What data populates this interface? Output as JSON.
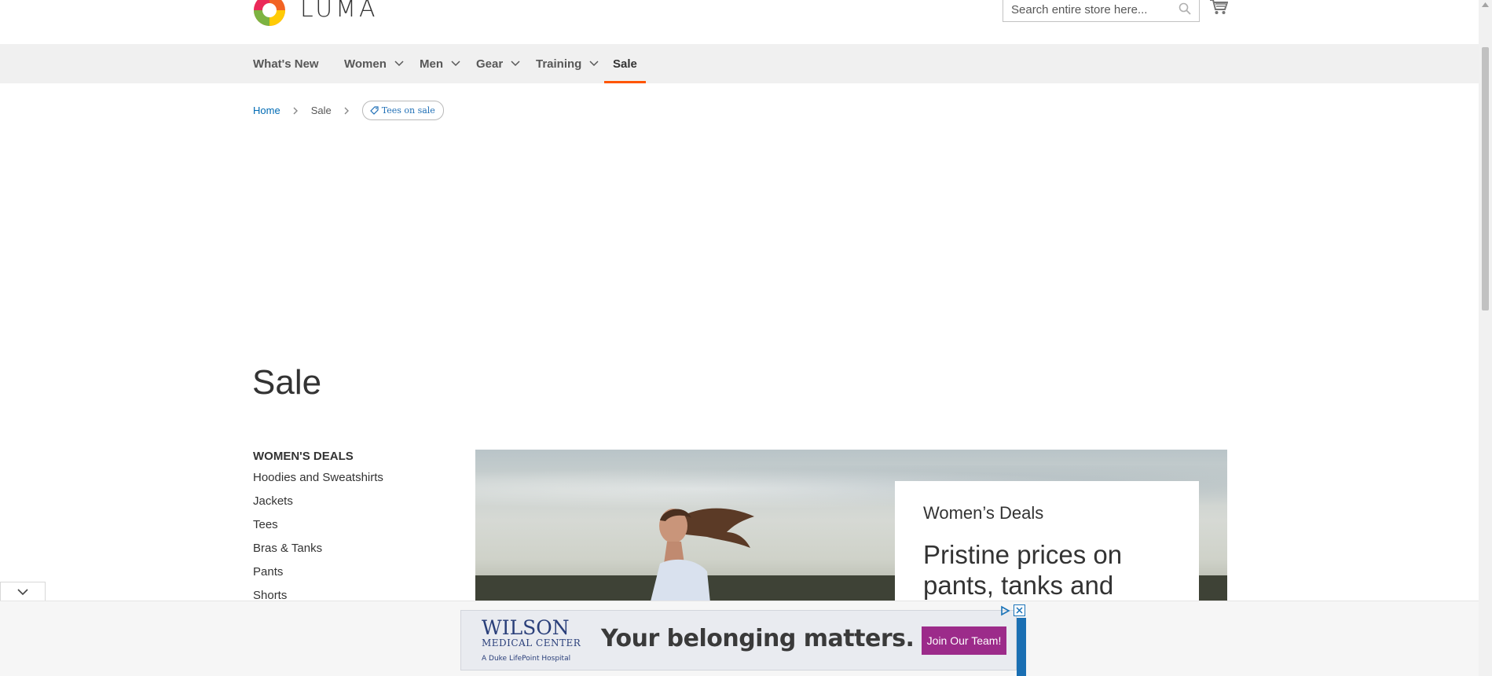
{
  "header": {
    "logo_text": "LUMA",
    "search_placeholder": "Search entire store here...",
    "search_icon": "search-icon",
    "cart_icon": "shopping-cart-icon"
  },
  "nav": {
    "items": [
      {
        "label": "What's New",
        "has_dropdown": false
      },
      {
        "label": "Women",
        "has_dropdown": true
      },
      {
        "label": "Men",
        "has_dropdown": true
      },
      {
        "label": "Gear",
        "has_dropdown": true
      },
      {
        "label": "Training",
        "has_dropdown": true
      },
      {
        "label": "Sale",
        "has_dropdown": false,
        "active": true
      }
    ],
    "active_color": "#ff5501"
  },
  "breadcrumbs": {
    "home": "Home",
    "sale": "Sale",
    "chip": "Tees on sale"
  },
  "page": {
    "title": "Sale"
  },
  "sidebar": {
    "title": "WOMEN'S DEALS",
    "links": [
      "Hoodies and Sweatshirts",
      "Jackets",
      "Tees",
      "Bras & Tanks",
      "Pants",
      "Shorts"
    ]
  },
  "hero": {
    "kicker": "Women’s Deals",
    "headline_line1": "Pristine prices on",
    "headline_line2": "pants, tanks and"
  },
  "ad": {
    "logo_line1": "WILSON",
    "logo_line2": "MEDICAL CENTER",
    "logo_line3": "A Duke LifePoint Hospital",
    "headline": "Your belonging matters.",
    "cta": "Join Our Team!",
    "cta_color": "#9c2b8a",
    "accent_color": "#1a6fb3"
  }
}
